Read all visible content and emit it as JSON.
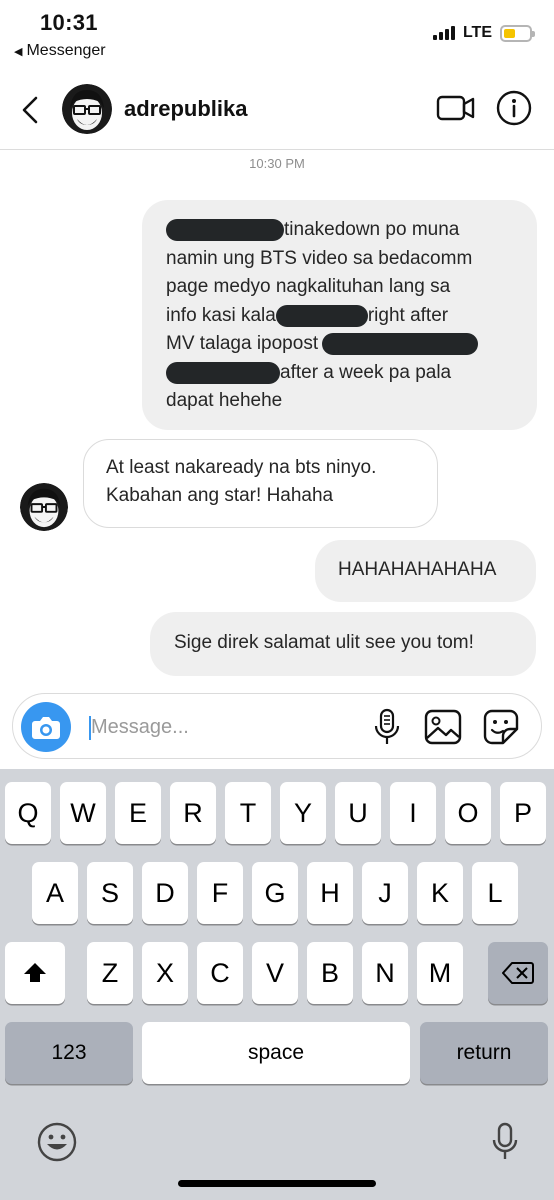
{
  "status_bar": {
    "time": "10:31",
    "back_app": "Messenger",
    "network": "LTE",
    "battery_level": 0.45,
    "battery_color": "#f5c400"
  },
  "header": {
    "username": "adrepublika",
    "icons": [
      "chevron-left-icon",
      "video-camera-icon",
      "info-icon"
    ]
  },
  "chat": {
    "timestamp": "10:30 PM",
    "messages": [
      {
        "direction": "outgoing",
        "lines": [
          [
            "",
            "tinakedown po muna"
          ],
          [
            "namin ung BTS video sa bedacomm"
          ],
          [
            "page medyo nagkalituhan lang sa"
          ],
          [
            "info kasi kala ",
            "",
            "right after"
          ],
          [
            "MV talaga ipopost ",
            ""
          ],
          [
            "",
            "after a week pa pala"
          ],
          [
            "dapat hehehe"
          ]
        ],
        "redacted": true
      },
      {
        "direction": "incoming",
        "lines": [
          "At least nakaready na bts ninyo.",
          "Kabahan ang star! Hahaha"
        ]
      },
      {
        "direction": "outgoing",
        "text": "HAHAHAHAHAHA"
      },
      {
        "direction": "outgoing",
        "text": "Sige direk salamat ulit see you tom!"
      }
    ]
  },
  "composer": {
    "placeholder": "Message...",
    "value": "",
    "accent": "#3897f0",
    "icons": [
      "camera-icon",
      "microphone-icon",
      "gallery-icon",
      "sticker-icon"
    ]
  },
  "keyboard": {
    "row1": [
      "Q",
      "W",
      "E",
      "R",
      "T",
      "Y",
      "U",
      "I",
      "O",
      "P"
    ],
    "row2": [
      "A",
      "S",
      "D",
      "F",
      "G",
      "H",
      "J",
      "K",
      "L"
    ],
    "row3": [
      "Z",
      "X",
      "C",
      "V",
      "B",
      "N",
      "M"
    ],
    "numbers_label": "123",
    "space_label": "space",
    "return_label": "return",
    "icons": [
      "shift-icon",
      "backspace-icon",
      "emoji-icon",
      "dictation-mic-icon"
    ]
  }
}
